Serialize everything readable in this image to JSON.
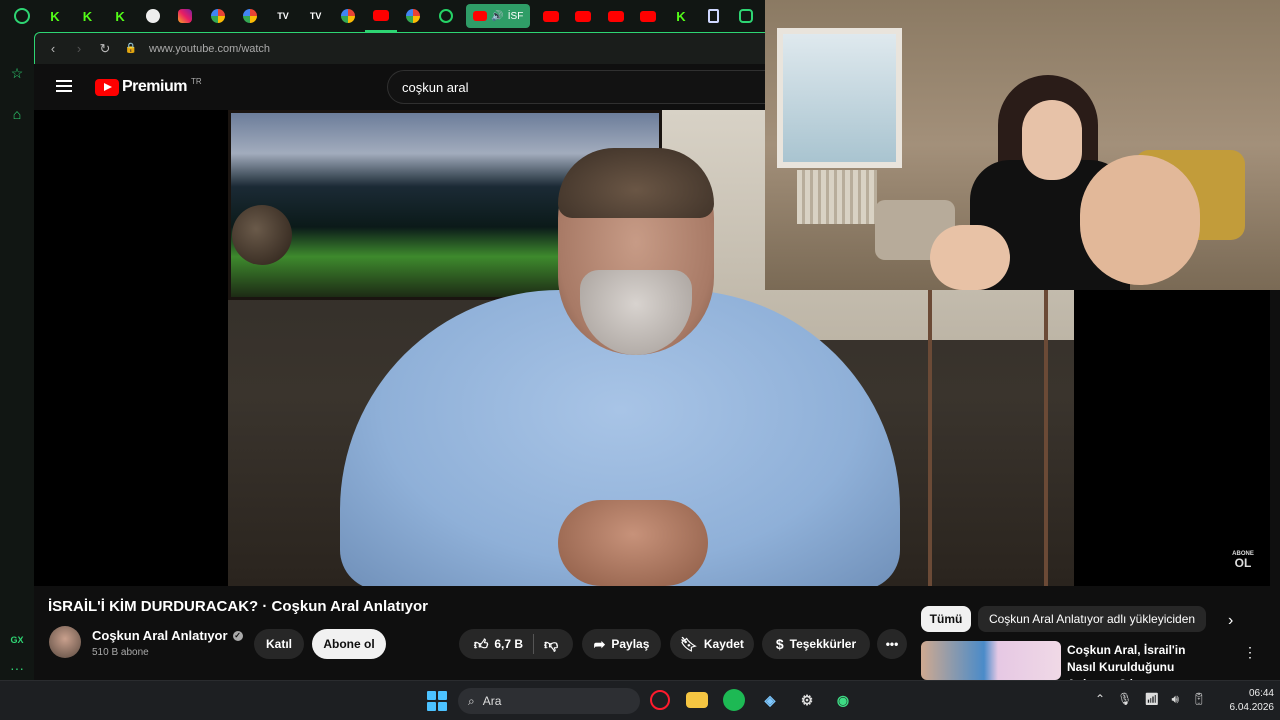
{
  "browser": {
    "url": "www.youtube.com/watch",
    "active_tab_label": "İSF",
    "tabs": [
      "opera-gx",
      "kick",
      "kick",
      "kick",
      "github",
      "instagram",
      "google",
      "google",
      "tradingview",
      "tradingview",
      "google",
      "youtube",
      "google",
      "whatsapp"
    ],
    "tabs_right": [
      "youtube",
      "youtube",
      "youtube",
      "youtube",
      "kick",
      "doc",
      "app"
    ]
  },
  "youtube": {
    "logo_text": "Premium",
    "region": "TR",
    "search_value": "coşkun aral"
  },
  "video": {
    "watermark_top": "ABONE",
    "watermark_bottom": "OL",
    "title": "İSRAİL'İ KİM DURDURACAK? · Coşkun Aral Anlatıyor",
    "channel_name": "Coşkun Aral Anlatıyor",
    "subscribers": "510 B abone",
    "join_label": "Katıl",
    "subscribe_label": "Abone ol",
    "likes": "6,7 B",
    "share_label": "Paylaş",
    "save_label": "Kaydet",
    "thanks_label": "Teşekkürler"
  },
  "recommendations": {
    "chips": [
      "Tümü",
      "Coşkun Aral Anlatıyor adlı yükleyiciden"
    ],
    "first_title": "Coşkun Aral, İsrail'in Nasıl Kurulduğunu Anlatıyor? | ..."
  },
  "sidebar": {
    "bottom_label": "GX"
  },
  "taskbar": {
    "search_placeholder": "Ara",
    "time": "06:44",
    "date": "6.04.2026"
  },
  "colors": {
    "gx_accent": "#2ed573",
    "youtube_red": "#ff0000",
    "taskbar_bg": "#1d1f22"
  }
}
